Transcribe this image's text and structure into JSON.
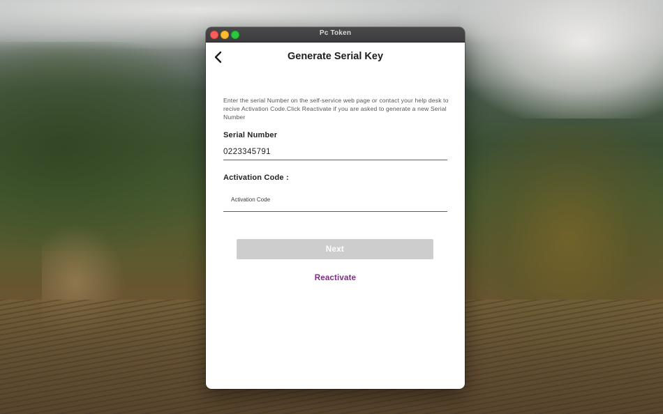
{
  "window": {
    "title": "Pc Token"
  },
  "page": {
    "title": "Generate Serial Key",
    "instructions": "Enter the serial Number on the self-service web page or contact your help desk to recive Activation Code.Click Reactivate if you are asked to generate a new Serial Number"
  },
  "serial": {
    "label": "Serial Number",
    "value": "0223345791"
  },
  "activation": {
    "label": "Activation Code :",
    "placeholder": "Activation Code",
    "value": ""
  },
  "actions": {
    "next_label": "Next",
    "reactivate_label": "Reactivate"
  },
  "icons": {
    "back": "chevron-left-icon"
  },
  "colors": {
    "accent": "#7a2e7e",
    "underline": "#8e3b8e",
    "button_disabled": "#cdcdcd",
    "close": "#fe5f57",
    "minimize": "#febc2e",
    "zoom": "#28c840"
  }
}
